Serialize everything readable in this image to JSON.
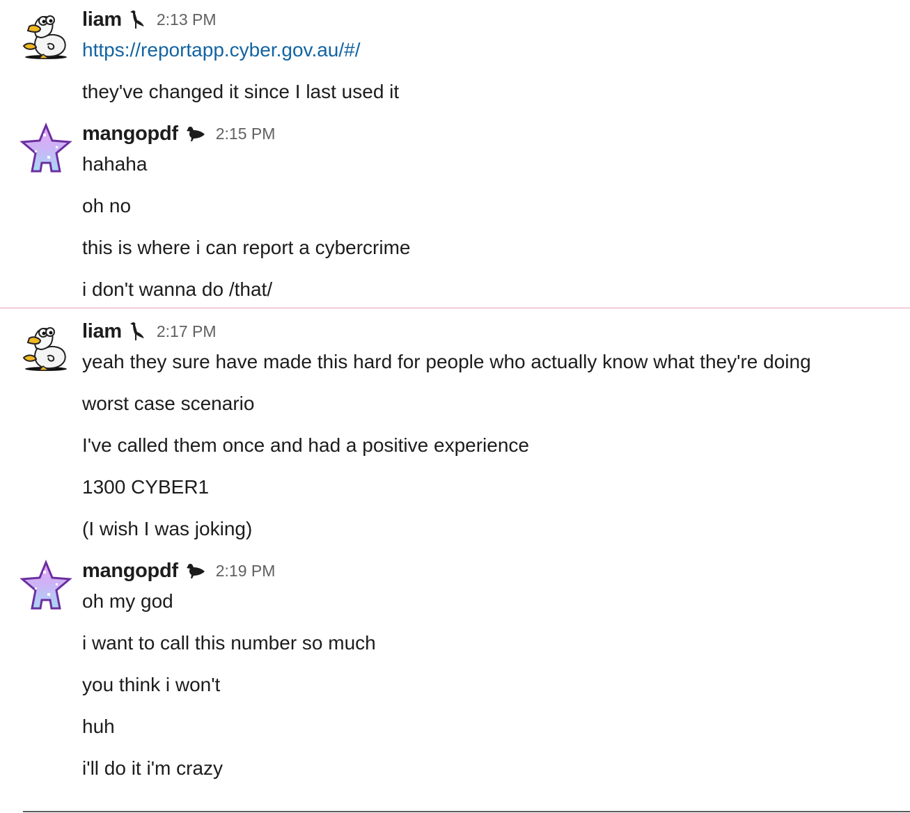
{
  "groups": [
    {
      "author": "liam",
      "time": "2:13 PM",
      "avatar": "duck-avatar",
      "badge": "heron-icon",
      "messages": [
        {
          "text": "https://reportapp.cyber.gov.au/#/",
          "is_link": true
        },
        {
          "text": "they've changed it since I last used it"
        }
      ]
    },
    {
      "author": "mangopdf",
      "time": "2:15 PM",
      "avatar": "pixel-star-avatar",
      "badge": "duck-icon",
      "messages": [
        {
          "text": "hahaha"
        },
        {
          "text": "oh no"
        },
        {
          "text": "this is where i can report a cybercrime"
        },
        {
          "text": "i don't wanna do /that/"
        }
      ]
    },
    {
      "author": "liam",
      "time": "2:17 PM",
      "avatar": "duck-avatar",
      "badge": "heron-icon",
      "messages": [
        {
          "text": "yeah they sure have made this hard for people who actually know what they're doing"
        },
        {
          "text": "worst case scenario"
        },
        {
          "text": "I've called them once and had a positive experience"
        },
        {
          "text": "1300 CYBER1"
        },
        {
          "text": "(I wish I was joking)"
        }
      ]
    },
    {
      "author": "mangopdf",
      "time": "2:19 PM",
      "avatar": "pixel-star-avatar",
      "badge": "duck-icon",
      "messages": [
        {
          "text": "oh my god"
        },
        {
          "text": "i want to call this number so much"
        },
        {
          "text": "you think i won't"
        },
        {
          "text": "huh"
        },
        {
          "text": "i'll do it i'm crazy"
        }
      ]
    }
  ],
  "colors": {
    "link": "#1264a3",
    "new_messages_divider": "#e8a0b4",
    "timestamp": "#616061",
    "text": "#1d1c1d"
  }
}
